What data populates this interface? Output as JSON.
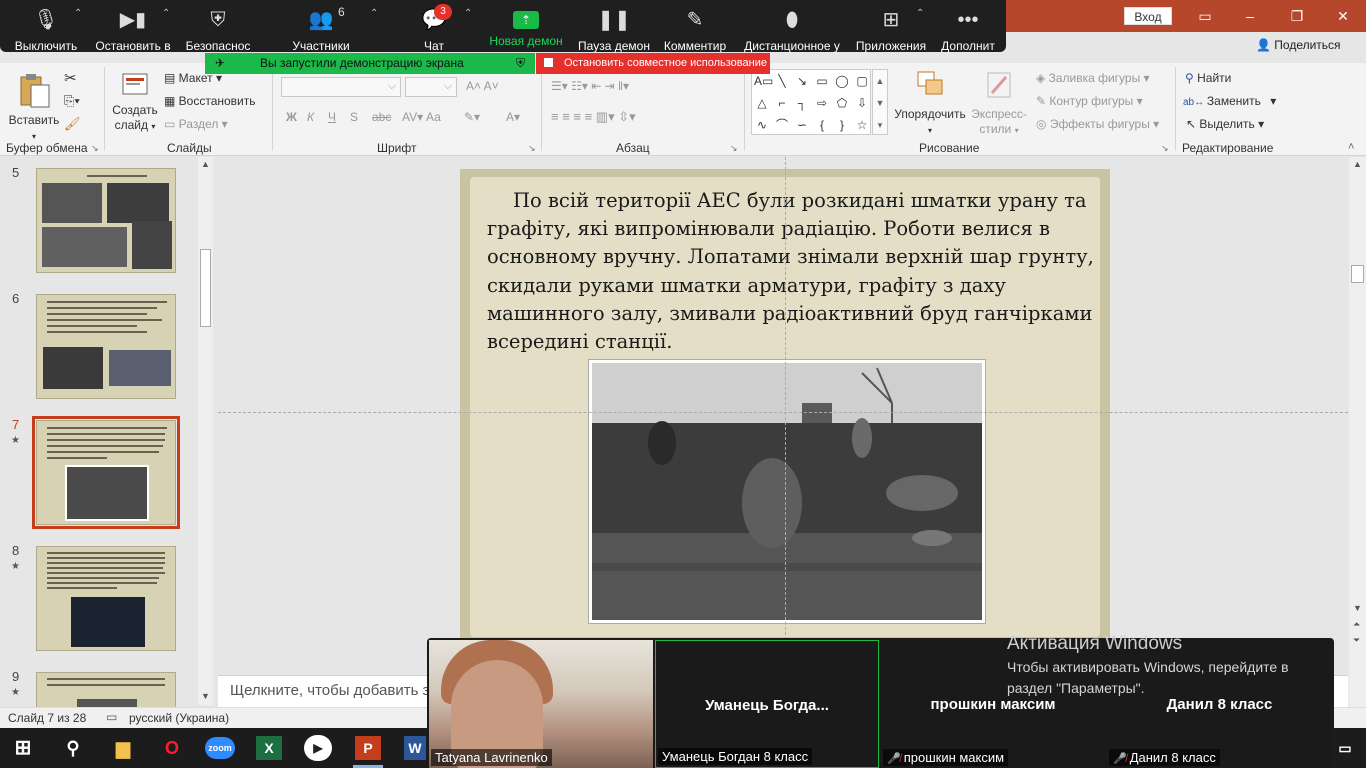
{
  "colors": {
    "titlebar": "#b7472a",
    "zoom_bar": "#1f1f1f",
    "share_green": "#1bb94a",
    "share_red": "#e5302b",
    "selected_thumb": "#c43e1c",
    "chat_badge": "#e5302b"
  },
  "titlebar": {
    "signin_label": "Вход",
    "share_label": "Поделиться"
  },
  "zoom_toolbar": {
    "mute_label": "Выключить",
    "video_label": "Остановить в",
    "security_label": "Безопаснос",
    "participants_label": "Участники",
    "participants_count": "6",
    "chat_label": "Чат",
    "chat_badge": "3",
    "new_share_label": "Новая демон",
    "pause_share_label": "Пауза демон",
    "annotate_label": "Комментир",
    "remote_control_label": "Дистанционное у",
    "apps_label": "Приложения",
    "more_label": "Дополнит"
  },
  "share_banner": {
    "started_text": "Вы запустили демонстрацию экрана",
    "stop_text": "Остановить совместное использование"
  },
  "ribbon": {
    "clipboard": {
      "paste_label": "Вставить",
      "group_title": "Буфер обмена"
    },
    "slides": {
      "new_slide_label_1": "Создать",
      "new_slide_label_2": "слайд",
      "layout_label": "Макет",
      "reset_label": "Восстановить",
      "section_label": "Раздел",
      "group_title": "Слайды"
    },
    "font": {
      "bold": "Ж",
      "italic": "К",
      "underline": "Ч",
      "strike": "S",
      "case": "Аа",
      "group_title": "Шрифт"
    },
    "paragraph": {
      "group_title": "Абзац"
    },
    "drawing": {
      "arrange_label": "Упорядочить",
      "quick_styles_label_1": "Экспресс-",
      "quick_styles_label_2": "стили",
      "fill_label": "Заливка фигуры",
      "outline_label": "Контур фигуры",
      "effects_label": "Эффекты фигуры",
      "group_title": "Рисование"
    },
    "editing": {
      "find_label": "Найти",
      "replace_label": "Заменить",
      "select_label": "Выделить",
      "group_title": "Редактирование"
    }
  },
  "thumbnails": [
    {
      "number": "5",
      "starred": false,
      "selected": false
    },
    {
      "number": "6",
      "starred": false,
      "selected": false
    },
    {
      "number": "7",
      "starred": true,
      "selected": true
    },
    {
      "number": "8",
      "starred": true,
      "selected": false
    },
    {
      "number": "9",
      "starred": true,
      "selected": false
    }
  ],
  "slide": {
    "body_text": "По всій території АЕС були розкидані шматки урану та графіту, які випромінювали радіацію. Роботи велися в основному вручну. Лопатами знімали верхній шар грунту, скидали руками шматки арматури, графіту з даху машинного залу, змивали радіоактивний бруд ганчірками всередині станції."
  },
  "notes": {
    "placeholder": "Щелкните, чтобы добавить за"
  },
  "statusbar": {
    "slide_position": "Слайд 7 из 28",
    "language": "русский (Украина)"
  },
  "gallery": {
    "participants": [
      {
        "label": "Tatyana Lavrinenko",
        "muted": false,
        "has_video": true
      },
      {
        "name": "Уманець  Богда...",
        "label": "Уманець Богдан 8 класс",
        "muted": false,
        "has_video": false,
        "active_speaker": true
      },
      {
        "name": "прошкин максим",
        "label": "прошкин максим",
        "muted": true,
        "has_video": false
      },
      {
        "name": "Данил 8 класс",
        "label": "Данил 8 класс",
        "muted": true,
        "has_video": false
      }
    ]
  },
  "activation": {
    "title": "Активация Windows",
    "line1": "Чтобы активировать Windows, перейдите в",
    "line2": "раздел \"Параметры\"."
  },
  "taskbar": {
    "icons": [
      "windows-start-icon",
      "search-icon",
      "file-explorer-icon",
      "opera-icon",
      "zoom-icon",
      "excel-icon",
      "media-player-icon",
      "powerpoint-icon",
      "word-icon"
    ]
  }
}
